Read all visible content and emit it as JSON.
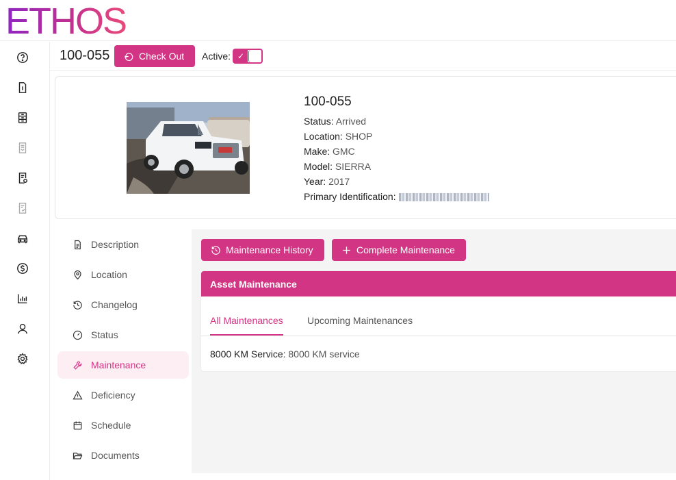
{
  "brand": {
    "logo_text": "ETHOS",
    "accent": "#d23583"
  },
  "rail": {
    "icons": [
      "help-icon",
      "info-document-icon",
      "file-cabinet-icon",
      "mail-document-icon",
      "document-settings-icon",
      "document-check-icon",
      "car-icon",
      "dollar-icon",
      "bar-chart-icon",
      "user-icon",
      "gear-icon"
    ]
  },
  "header": {
    "asset_id": "100-055",
    "checkout_label": "Check Out",
    "active_label": "Active:",
    "active": true
  },
  "asset": {
    "name": "100-055",
    "status_label": "Status:",
    "status": "Arrived",
    "location_label": "Location:",
    "location": "SHOP",
    "make_label": "Make:",
    "make": "GMC",
    "model_label": "Model:",
    "model": "SIERRA",
    "year_label": "Year:",
    "year": "2017",
    "primary_id_label": "Primary Identification:"
  },
  "nav": {
    "items": [
      {
        "label": "Description",
        "icon": "document-icon"
      },
      {
        "label": "Location",
        "icon": "map-pin-icon"
      },
      {
        "label": "Changelog",
        "icon": "history-icon"
      },
      {
        "label": "Status",
        "icon": "gauge-icon"
      },
      {
        "label": "Maintenance",
        "icon": "wrench-icon",
        "active": true
      },
      {
        "label": "Deficiency",
        "icon": "warning-icon"
      },
      {
        "label": "Schedule",
        "icon": "calendar-icon"
      },
      {
        "label": "Documents",
        "icon": "folder-icon"
      }
    ]
  },
  "maintenance": {
    "history_button": "Maintenance History",
    "complete_button": "Complete Maintenance",
    "card_title": "Asset Maintenance",
    "tabs": [
      {
        "label": "All Maintenances",
        "active": true
      },
      {
        "label": "Upcoming Maintenances",
        "active": false
      }
    ],
    "entries": [
      {
        "name": "8000 KM Service:",
        "description": "8000 KM service"
      }
    ]
  }
}
